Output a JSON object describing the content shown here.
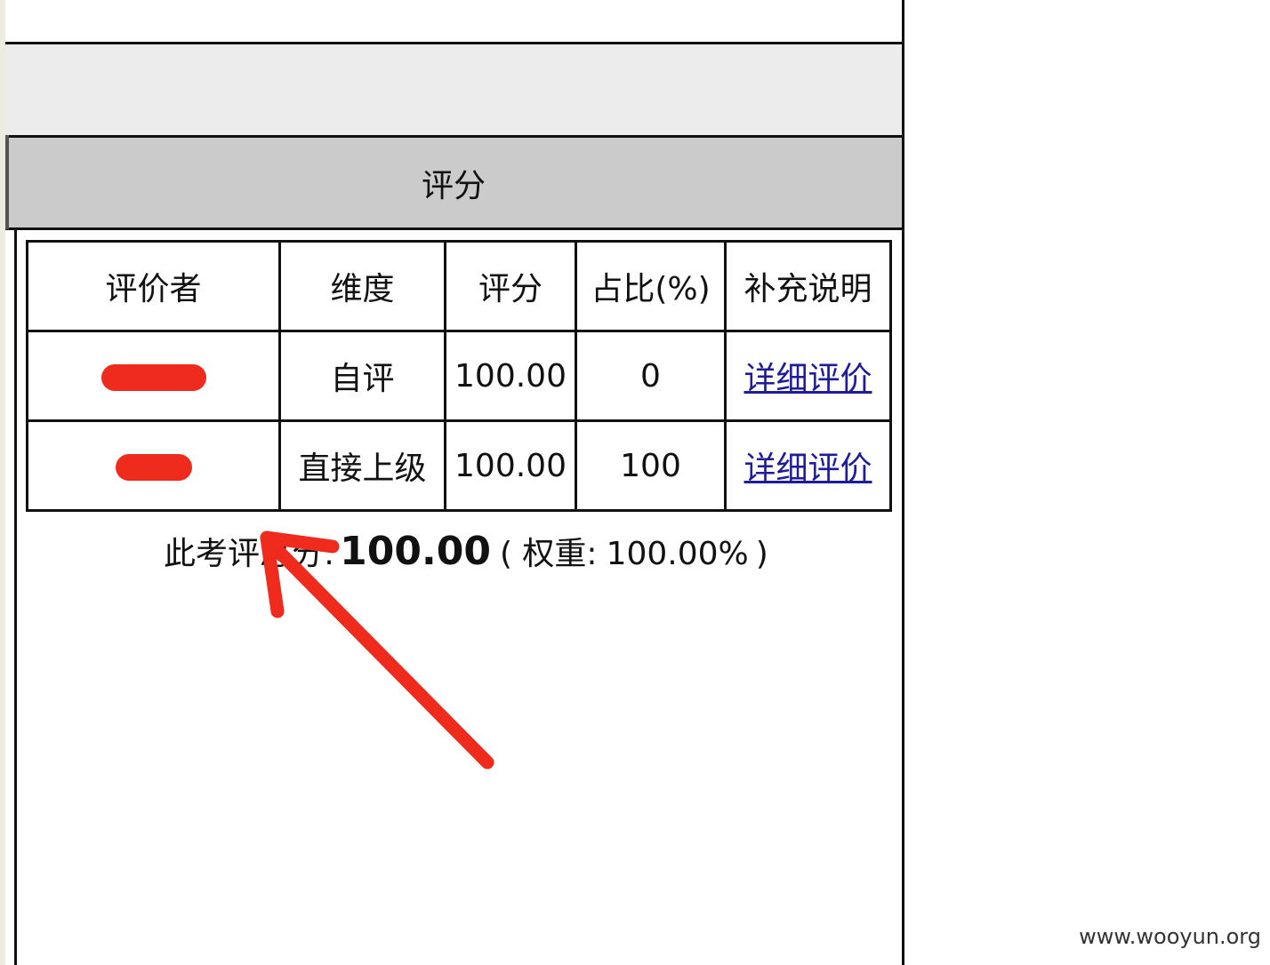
{
  "section_header": "评分",
  "table": {
    "headers": [
      "评价者",
      "维度",
      "评分",
      "占比(%)",
      "补充说明"
    ],
    "rows": [
      {
        "evaluator": "",
        "dimension": "自评",
        "score": "100.00",
        "ratio": "0",
        "detail_link": "详细评价"
      },
      {
        "evaluator": "",
        "dimension": "直接上级",
        "score": "100.00",
        "ratio": "100",
        "detail_link": "详细评价"
      }
    ]
  },
  "summary": {
    "label": "此考评总分:",
    "total": "100.00",
    "weight_label": "( 权重:",
    "weight": "100.00%",
    "close": ")"
  },
  "watermark": "www.wooyun.org",
  "colors": {
    "annotation": "#ef2b1e",
    "link": "#1d1d9c",
    "header_bg": "#cbcbcb"
  }
}
